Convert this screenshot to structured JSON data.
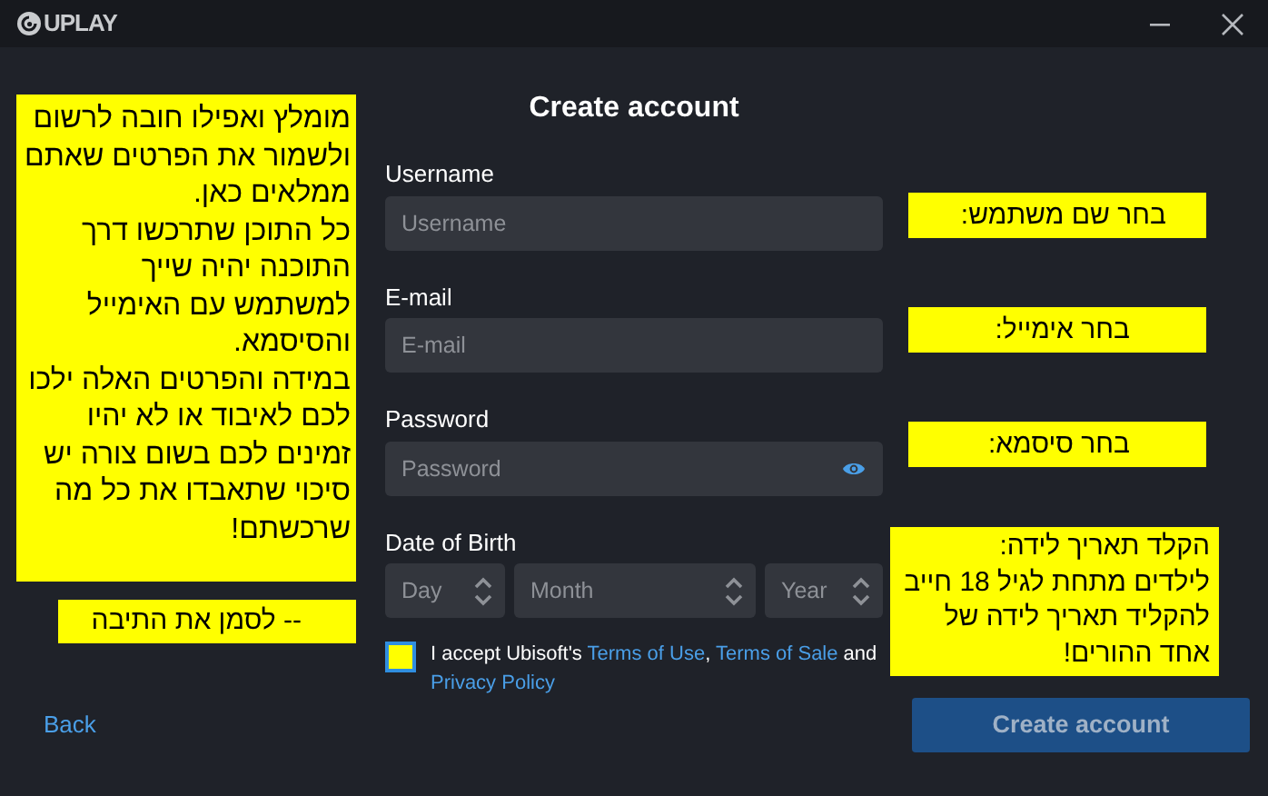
{
  "window": {
    "title": "UPLAY"
  },
  "form": {
    "title": "Create account",
    "fields": [
      {
        "label": "Username",
        "placeholder": "Username",
        "kind": "text"
      },
      {
        "label": "E-mail",
        "placeholder": "E-mail",
        "kind": "text"
      },
      {
        "label": "Password",
        "placeholder": "Password",
        "kind": "password"
      }
    ],
    "date_of_birth": {
      "label": "Date of Birth",
      "day": {
        "placeholder": "Day"
      },
      "month": {
        "placeholder": "Month"
      },
      "year": {
        "placeholder": "Year"
      }
    },
    "terms": {
      "checked": false,
      "intro": "I accept Ubisoft's",
      "terms_of_use": "Terms of Use",
      "separator": ",",
      "terms_of_sale": "Terms of Sale",
      "conjunction": "and",
      "privacy_policy": "Privacy Policy"
    }
  },
  "footer": {
    "back": "Back",
    "submit": "Create account"
  },
  "annotations": [
    {
      "paragraphs": [
        "מומלץ ואפילו חובה לרשום ולשמור את הפרטים שאתם ממלאים כאן.",
        "כל התוכן שתרכשו דרך התוכנה יהיה שייך למשתמש עם האימייל והסיסמא.",
        "במידה והפרטים האלה ילכו לכם לאיבוד או לא יהיו זמינים לכם בשום צורה יש סיכוי שתאבדו את כל מה שרכשתם!"
      ]
    },
    {
      "paragraphs": [
        "-- לסמן את התיבה"
      ]
    },
    {
      "paragraphs": [
        "בחר שם משתמש:"
      ]
    },
    {
      "paragraphs": [
        "בחר אימייל:"
      ]
    },
    {
      "paragraphs": [
        "בחר סיסמא:"
      ]
    },
    {
      "paragraphs": [
        "הקלד תאריך לידה:",
        "לילדים מתחת לגיל 18 חייב להקליד תאריך לידה של אחד ההורים!"
      ]
    }
  ]
}
